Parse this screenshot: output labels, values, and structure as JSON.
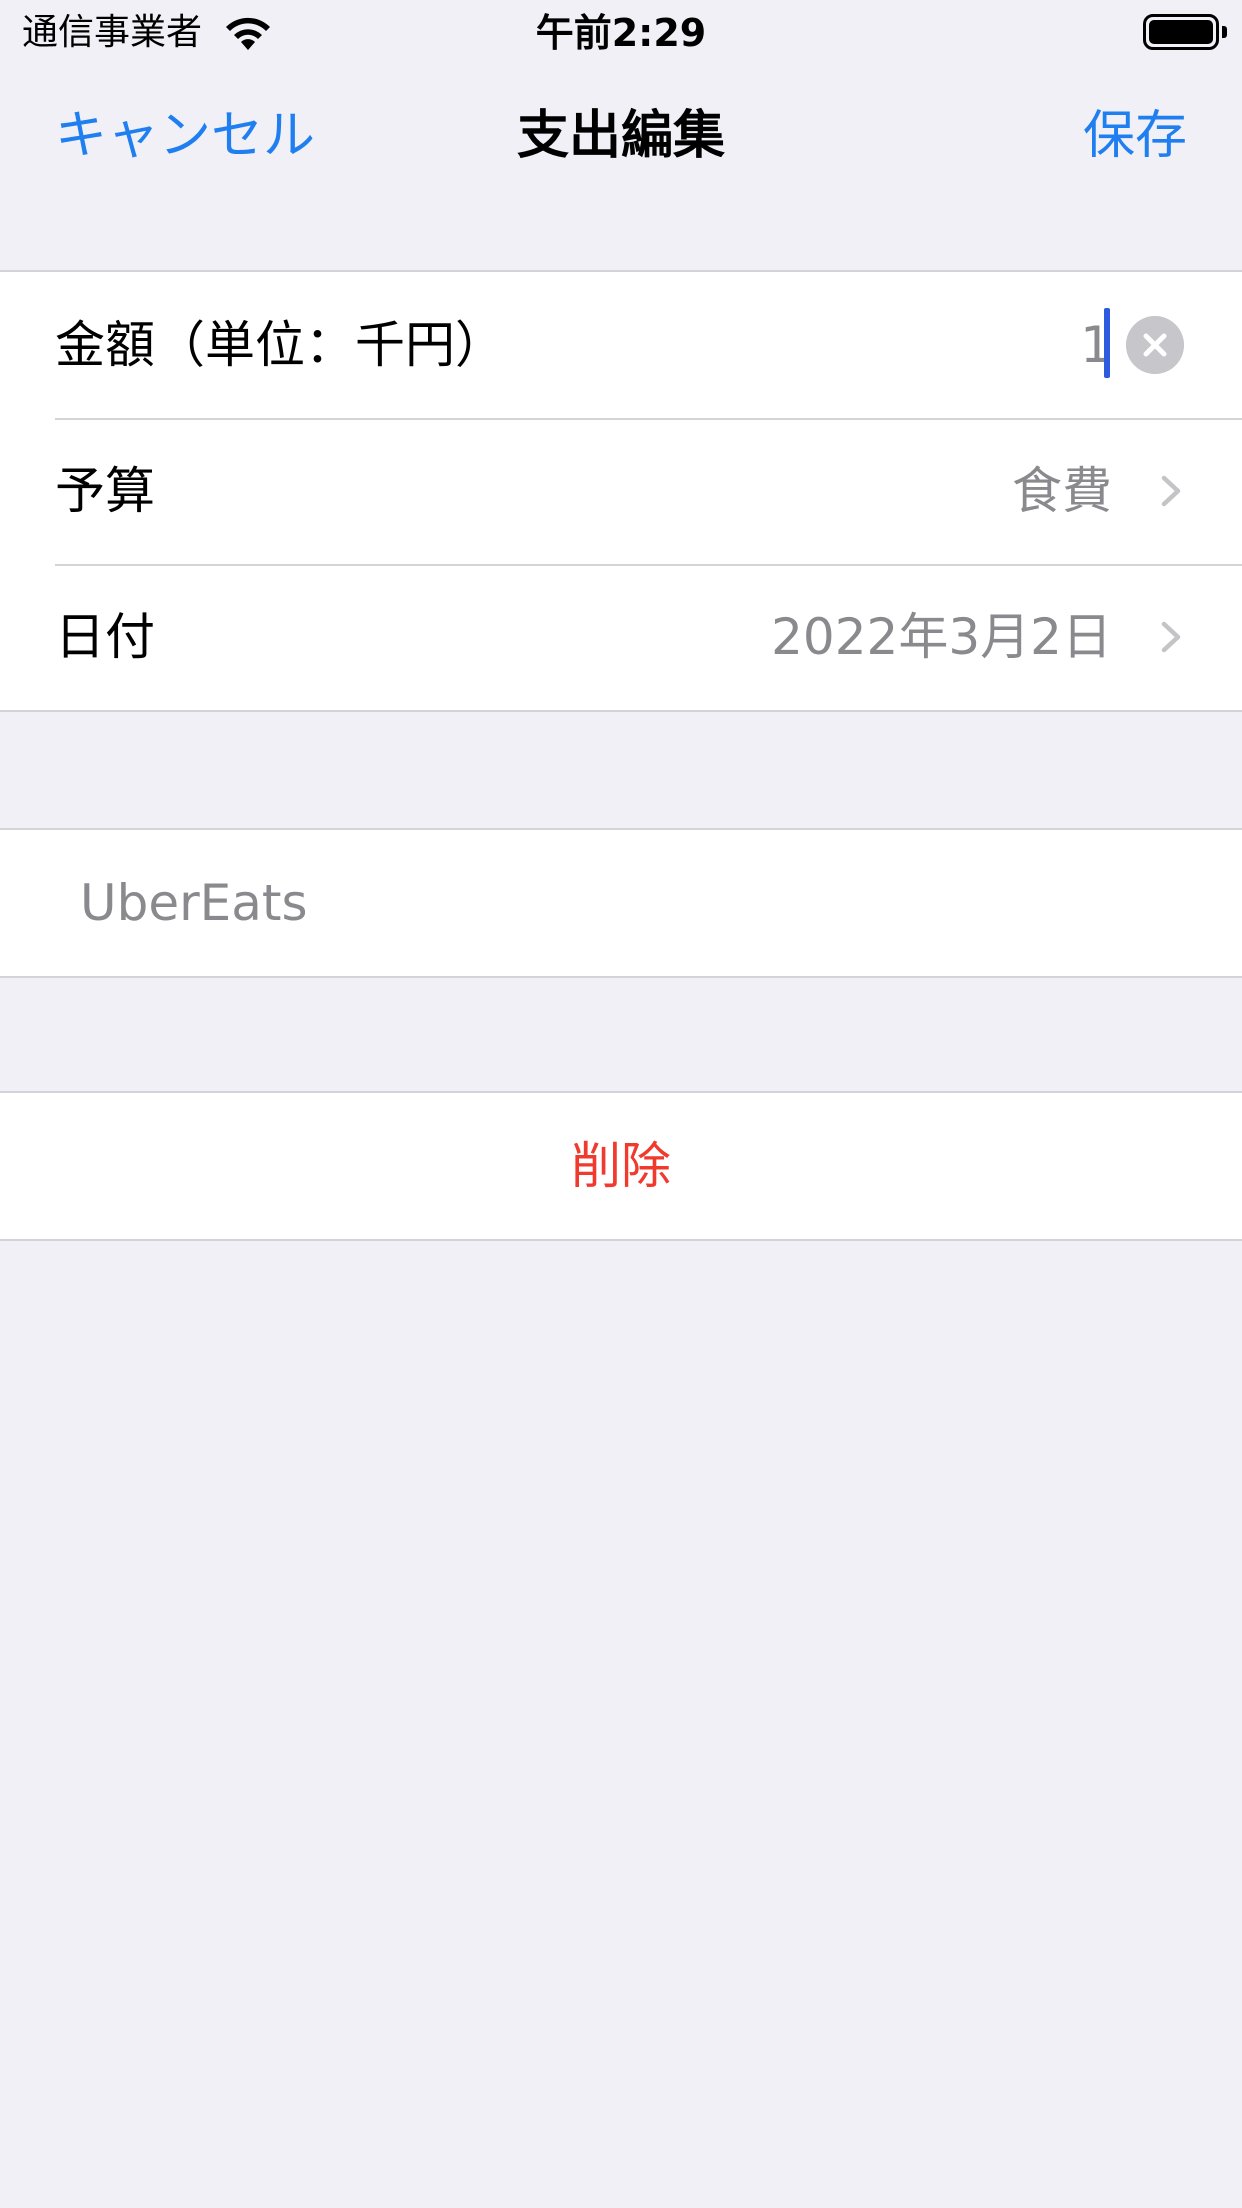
{
  "status_bar": {
    "carrier": "通信事業者",
    "time": "午前2:29"
  },
  "nav": {
    "cancel_label": "キャンセル",
    "title": "支出編集",
    "save_label": "保存"
  },
  "form": {
    "amount": {
      "label": "金額（単位：千円）",
      "value": "1"
    },
    "budget": {
      "label": "予算",
      "value": "食費"
    },
    "date": {
      "label": "日付",
      "value": "2022年3月2日"
    }
  },
  "memo": {
    "value": "UberEats"
  },
  "actions": {
    "delete_label": "削除"
  },
  "colors": {
    "accent": "#1f7ff0",
    "destructive": "#f03a2e",
    "background": "#f0f0f6",
    "secondary_text": "#8a8a8e"
  },
  "icons": [
    "wifi-icon",
    "battery-icon",
    "clear-icon",
    "chevron-right-icon"
  ]
}
